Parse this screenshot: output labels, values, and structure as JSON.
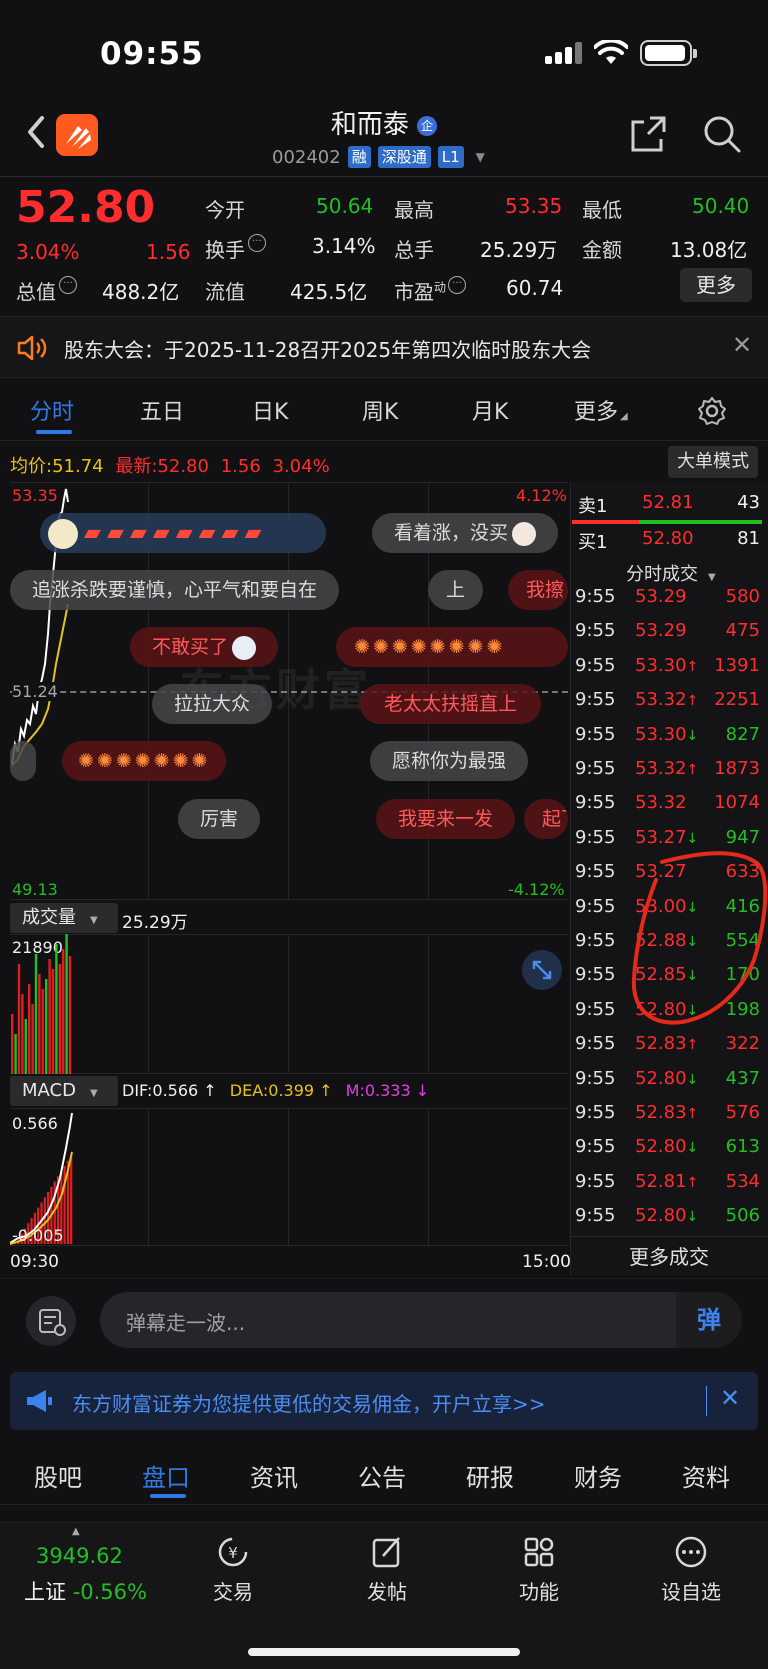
{
  "status_bar": {
    "time": "09:55"
  },
  "header": {
    "stock_name": "和而泰",
    "name_badge": "企",
    "code": "002402",
    "badges": [
      "融",
      "深股通",
      "L1"
    ]
  },
  "quote": {
    "price": "52.80",
    "change_pct": "3.04%",
    "change": "1.56",
    "open_label": "今开",
    "open": "50.64",
    "high_label": "最高",
    "high": "53.35",
    "low_label": "最低",
    "low": "50.40",
    "turnover_label": "换手",
    "turnover": "3.14%",
    "volume_label": "总手",
    "volume": "25.29万",
    "amount_label": "金额",
    "amount": "13.08亿",
    "mktcap_label": "总值",
    "mktcap": "488.2亿",
    "float_label": "流值",
    "float_cap": "425.5亿",
    "pe_label": "市盈",
    "pe_sup": "动",
    "pe": "60.74",
    "more_label": "更多"
  },
  "notice": {
    "text": "股东大会：于2025-11-28召开2025年第四次临时股东大会"
  },
  "chart_tabs": [
    "分时",
    "五日",
    "日K",
    "周K",
    "月K",
    "更多"
  ],
  "chart_info": {
    "avg_label": "均价:",
    "avg": "51.74",
    "latest_label": "最新:",
    "latest": "52.80",
    "latest_change": "1.56",
    "latest_pct": "3.04%",
    "mode_button": "大单模式"
  },
  "chart_axis": {
    "top_price": "53.35",
    "top_pct": "4.12%",
    "mid_price": "51.24",
    "bottom_price": "49.13",
    "bottom_pct": "-4.12%",
    "start_time": "09:30",
    "end_time": "15:00"
  },
  "volume_panel": {
    "label": "成交量",
    "total": "25.29万",
    "max": "21890"
  },
  "macd_panel": {
    "label": "MACD",
    "dif": "DIF:0.566 ↑",
    "dea": "DEA:0.399 ↑",
    "m": "M:0.333 ↓",
    "top": "0.566",
    "bottom": "-0.005"
  },
  "danmu": {
    "d1": "看着涨，没买",
    "d2": "追涨杀跌要谨慎，心平气和要自在",
    "d3": "上",
    "d4": "我擦",
    "d5": "不敢买了",
    "d6": "拉拉大众",
    "d7": "老太太扶摇直上",
    "d8": "愿称你为最强",
    "d9": "厉害",
    "d10": "我要来一发",
    "d11": "起飞",
    "watermark": "东方财富"
  },
  "order_book": {
    "sell_label": "卖1",
    "sell_price": "52.81",
    "sell_vol": "43",
    "buy_label": "买1",
    "buy_price": "52.80",
    "buy_vol": "81",
    "trades_title": "分时成交"
  },
  "trades": [
    {
      "time": "9:55",
      "price": "53.29",
      "arrow": "",
      "vol": "580",
      "color": "red"
    },
    {
      "time": "9:55",
      "price": "53.29",
      "arrow": "",
      "vol": "475",
      "color": "red"
    },
    {
      "time": "9:55",
      "price": "53.30",
      "arrow": "↑",
      "vol": "1391",
      "color": "red"
    },
    {
      "time": "9:55",
      "price": "53.32",
      "arrow": "↑",
      "vol": "2251",
      "color": "red"
    },
    {
      "time": "9:55",
      "price": "53.30",
      "arrow": "↓",
      "vol": "827",
      "color": "green"
    },
    {
      "time": "9:55",
      "price": "53.32",
      "arrow": "↑",
      "vol": "1873",
      "color": "red"
    },
    {
      "time": "9:55",
      "price": "53.32",
      "arrow": "",
      "vol": "1074",
      "color": "red"
    },
    {
      "time": "9:55",
      "price": "53.27",
      "arrow": "↓",
      "vol": "947",
      "color": "green"
    },
    {
      "time": "9:55",
      "price": "53.27",
      "arrow": "",
      "vol": "633",
      "color": "red"
    },
    {
      "time": "9:55",
      "price": "53.00",
      "arrow": "↓",
      "vol": "416",
      "color": "green"
    },
    {
      "time": "9:55",
      "price": "52.88",
      "arrow": "↓",
      "vol": "554",
      "color": "green"
    },
    {
      "time": "9:55",
      "price": "52.85",
      "arrow": "↓",
      "vol": "170",
      "color": "green"
    },
    {
      "time": "9:55",
      "price": "52.80",
      "arrow": "↓",
      "vol": "198",
      "color": "green"
    },
    {
      "time": "9:55",
      "price": "52.83",
      "arrow": "↑",
      "vol": "322",
      "color": "red"
    },
    {
      "time": "9:55",
      "price": "52.80",
      "arrow": "↓",
      "vol": "437",
      "color": "green"
    },
    {
      "time": "9:55",
      "price": "52.83",
      "arrow": "↑",
      "vol": "576",
      "color": "red"
    },
    {
      "time": "9:55",
      "price": "52.80",
      "arrow": "↓",
      "vol": "613",
      "color": "green"
    },
    {
      "time": "9:55",
      "price": "52.81",
      "arrow": "↑",
      "vol": "534",
      "color": "red"
    },
    {
      "time": "9:55",
      "price": "52.80",
      "arrow": "↓",
      "vol": "506",
      "color": "green"
    }
  ],
  "trades_more": "更多成交",
  "comment": {
    "placeholder": "弹幕走一波...",
    "send_label": "弹"
  },
  "ad": {
    "text": "东方财富证券为您提供更低的交易佣金，开户立享>>"
  },
  "bottom_tabs": [
    "股吧",
    "盘口",
    "资讯",
    "公告",
    "研报",
    "财务",
    "资料"
  ],
  "dock": {
    "index_value": "3949.62",
    "index_name": "上证",
    "index_change": "-0.56%",
    "items": [
      "交易",
      "发帖",
      "功能",
      "设自选"
    ]
  },
  "colors": {
    "up": "#ff2d2d",
    "down": "#20c020",
    "accent": "#2f7ae5",
    "background": "#111113"
  }
}
